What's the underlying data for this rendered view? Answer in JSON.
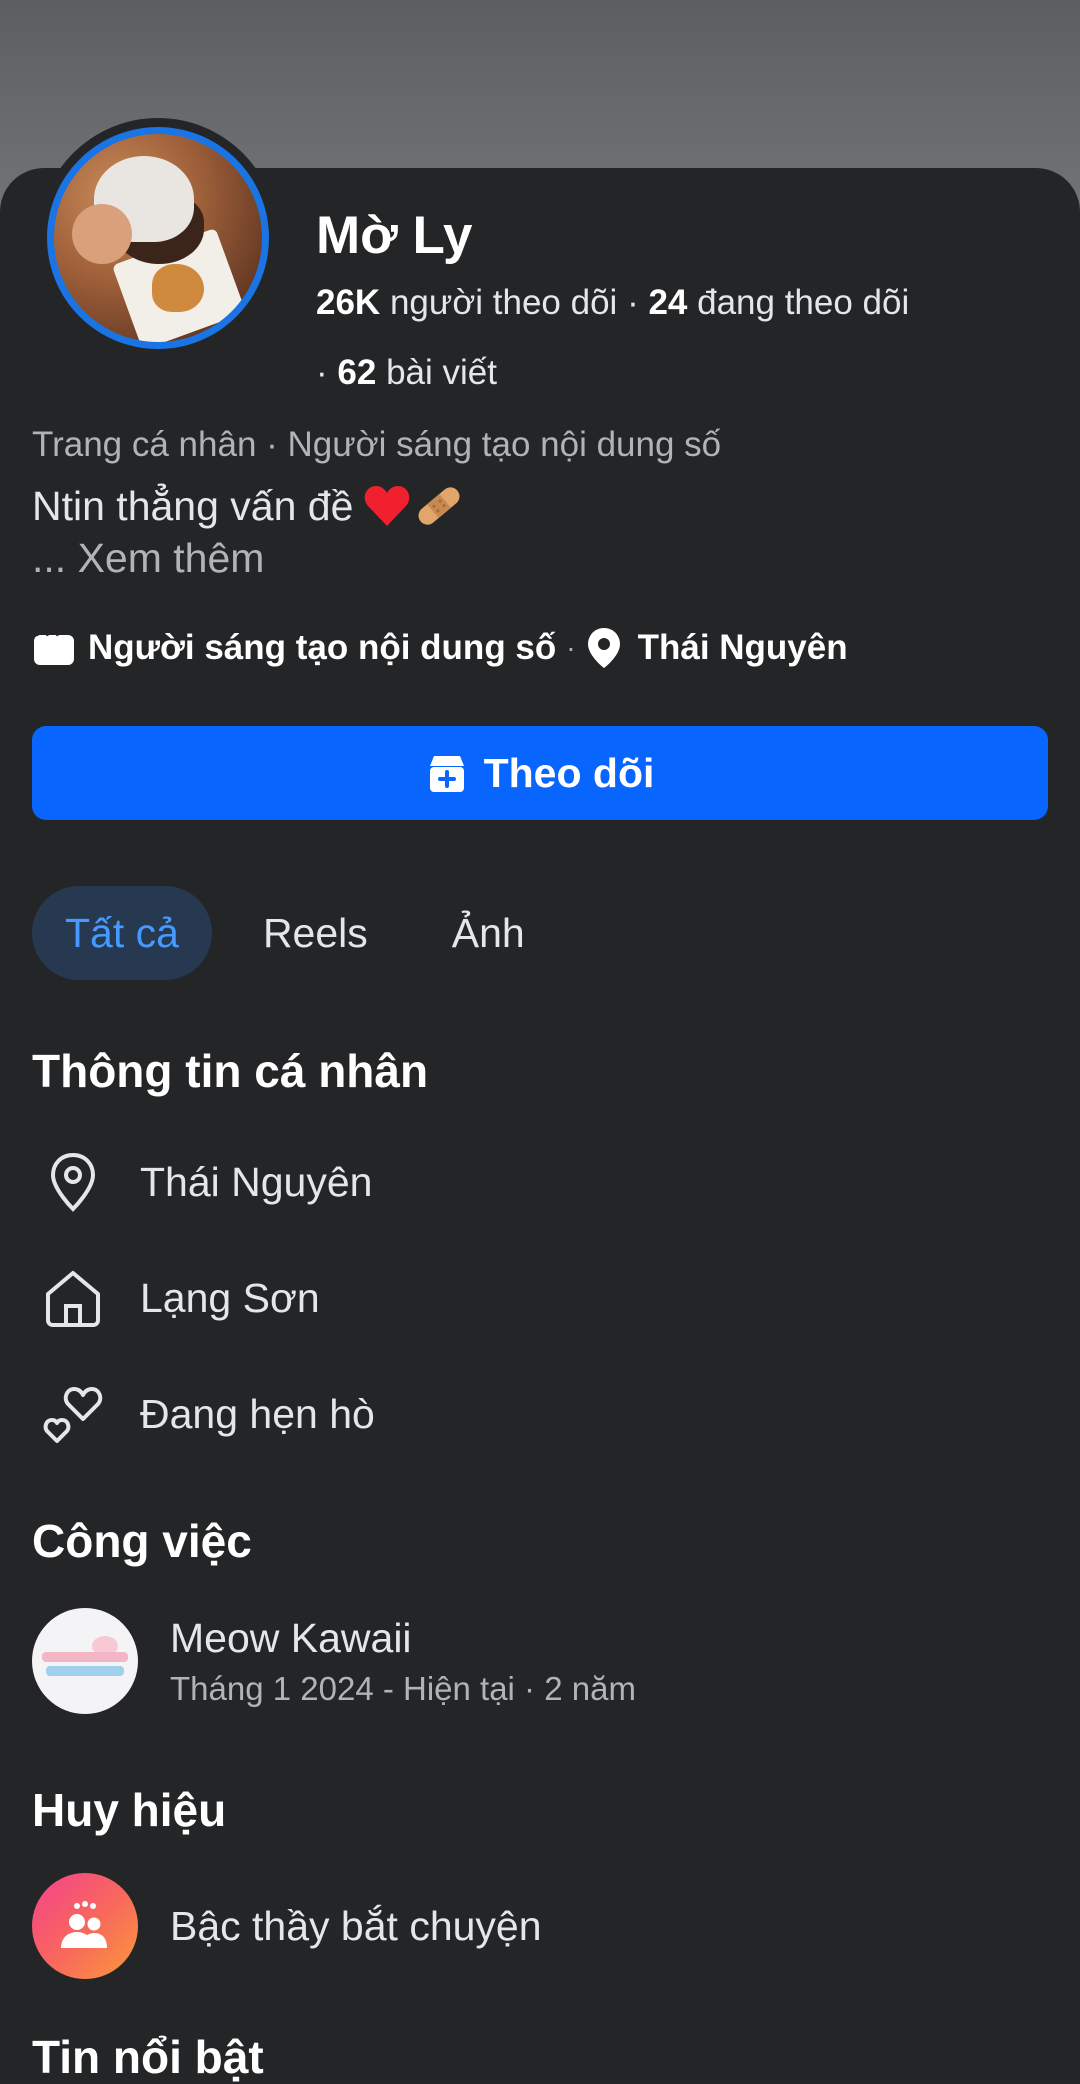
{
  "colors": {
    "background": "#242526",
    "accent": "#0866ff",
    "avatar_ring": "#1b74e4",
    "tab_active_bg": "#263951",
    "tab_active_text": "#4599ff",
    "secondary_text": "#b0b3b8"
  },
  "profile": {
    "name": "Mờ Ly",
    "followers_count": "26K",
    "followers_label": "người theo dõi",
    "following_count": "24",
    "following_label": "đang theo dõi",
    "posts_count": "62",
    "posts_label": "bài viết",
    "subtitle": "Trang cá nhân · Người sáng tạo nội dung số",
    "bio": "Ntin thẳng vấn đề",
    "see_more": "... Xem thêm",
    "meta_category": "Người sáng tạo nội dung số",
    "meta_location": "Thái Nguyên",
    "avatar_icon": "profile-photo"
  },
  "actions": {
    "follow_label": "Theo dõi",
    "follow_icon": "follow-page-icon"
  },
  "tabs": [
    {
      "label": "Tất cả",
      "active": true
    },
    {
      "label": "Reels",
      "active": false
    },
    {
      "label": "Ảnh",
      "active": false
    }
  ],
  "personal_info": {
    "title": "Thông tin cá nhân",
    "items": [
      {
        "icon": "location-pin-icon",
        "label": "Thái Nguyên"
      },
      {
        "icon": "home-icon",
        "label": "Lạng Sơn"
      },
      {
        "icon": "hearts-icon",
        "label": "Đang hẹn hò"
      }
    ]
  },
  "work": {
    "title": "Công việc",
    "name": "Meow Kawaii",
    "period": "Tháng 1 2024 - Hiện tại · 2 năm"
  },
  "badges": {
    "title": "Huy hiệu",
    "label": "Bậc thầy bắt chuyện",
    "icon": "community-people-icon"
  },
  "highlights": {
    "title": "Tin nổi bật"
  }
}
